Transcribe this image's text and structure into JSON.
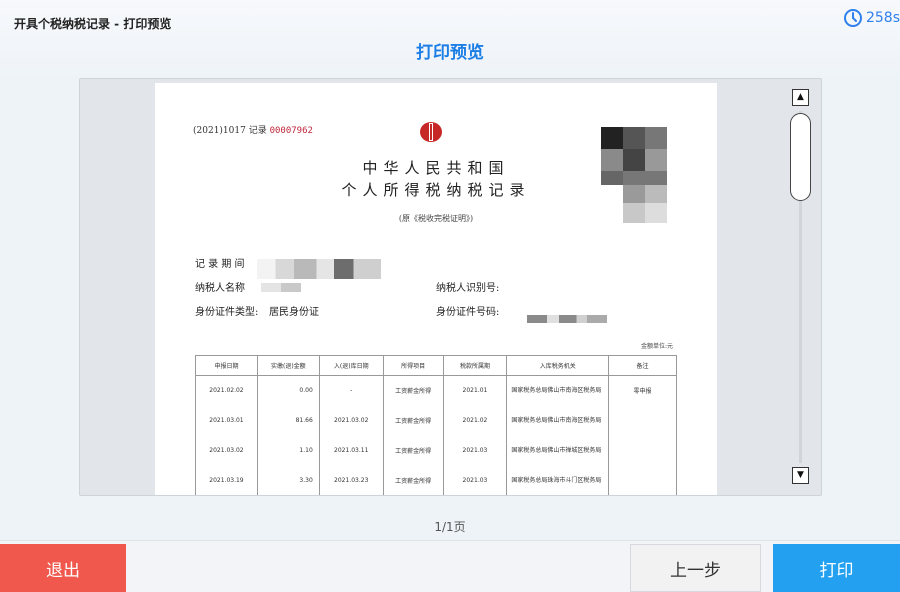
{
  "window_title": "开具个税纳税记录 - 打印预览",
  "timer": {
    "value": "258s",
    "icon": "clock-icon",
    "color": "#2f80ed"
  },
  "page_title": "打印预览",
  "document": {
    "record_prefix": "(2021)1017 记录",
    "record_number": "00007962",
    "title_line1": "中华人民共和国",
    "title_line2": "个人所得税纳税记录",
    "subtitle": "(原《税收完税证明》)",
    "label_period": "记 录 期 间",
    "label_name": "纳税人名称",
    "label_taxid": "纳税人识别号:",
    "label_id_type": "身份证件类型:",
    "id_type_value": "居民身份证",
    "label_id_number": "身份证件号码:",
    "unit": "金额单位:元",
    "table": {
      "headers": [
        "申报日期",
        "实缴(退)金额",
        "入(退)库日期",
        "所得项目",
        "税款所属期",
        "入库税务机关",
        "备注"
      ],
      "rows": [
        [
          "2021.02.02",
          "0.00",
          "-",
          "工资薪金所得",
          "2021.01",
          "国家税务总局佛山市南海区税务局",
          "零申报"
        ],
        [
          "2021.03.01",
          "81.66",
          "2021.03.02",
          "工资薪金所得",
          "2021.02",
          "国家税务总局佛山市南海区税务局",
          ""
        ],
        [
          "2021.03.02",
          "1.10",
          "2021.03.11",
          "工资薪金所得",
          "2021.03",
          "国家税务总局佛山市禅城区税务局",
          ""
        ],
        [
          "2021.03.19",
          "3.30",
          "2021.03.23",
          "工资薪金所得",
          "2021.03",
          "国家税务总局珠海市斗门区税务局",
          ""
        ]
      ]
    }
  },
  "zoom_in_icon": "zoom-in-icon",
  "zoom_out_icon": "zoom-out-icon",
  "pager": "1/1页",
  "buttons": {
    "exit": "退出",
    "prev": "上一步",
    "print": "打印"
  },
  "colors": {
    "accent": "#1d7fe6",
    "exit": "#f0584d",
    "print": "#23a1f0",
    "record_no": "#c0253a"
  }
}
